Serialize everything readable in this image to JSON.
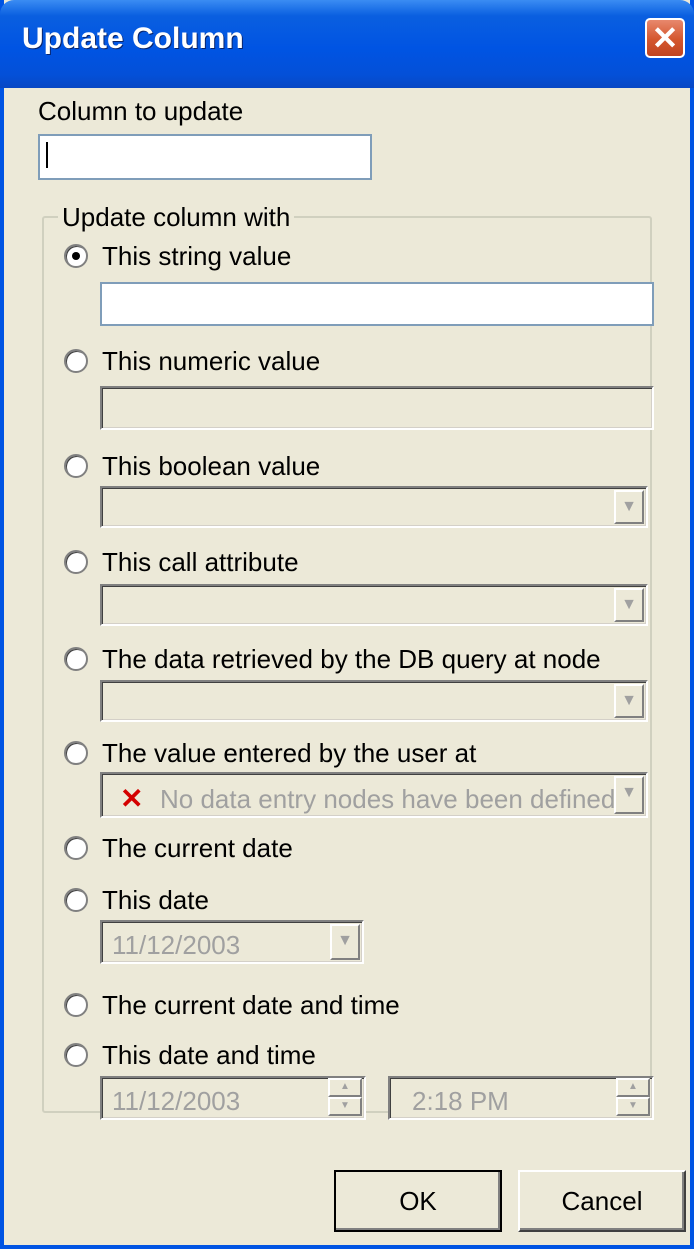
{
  "window": {
    "title": "Update Column",
    "close_glyph": "✕"
  },
  "column_to_update": {
    "label": "Column to update",
    "value": ""
  },
  "group": {
    "legend": "Update column with",
    "options": [
      {
        "label": "This string value",
        "checked": true
      },
      {
        "label": "This numeric value",
        "checked": false
      },
      {
        "label": "This boolean value",
        "checked": false
      },
      {
        "label": "This call attribute",
        "checked": false
      },
      {
        "label": "The data retrieved by the DB query at node",
        "checked": false
      },
      {
        "label": "The value entered by the user at",
        "checked": false
      },
      {
        "label": "The current date",
        "checked": false
      },
      {
        "label": "This date",
        "checked": false
      },
      {
        "label": "The current date and time",
        "checked": false
      },
      {
        "label": "This date and time",
        "checked": false
      }
    ],
    "string_value": "",
    "numeric_value": "",
    "boolean_value": "",
    "call_attribute": "",
    "db_query_node": "",
    "user_entry_node": "No data entry nodes have been defined.",
    "date_value": "11/12/2003",
    "datetime_date": "11/12/2003",
    "datetime_time": "2:18 PM"
  },
  "buttons": {
    "ok": "OK",
    "cancel": "Cancel"
  },
  "icons": {
    "error": "red-x-icon",
    "dropdown": "chevron-down-icon",
    "spin_up": "spin-up-icon",
    "spin_down": "spin-down-icon"
  },
  "colors": {
    "titlebar": "#0054e3",
    "face": "#ece9d8",
    "close": "#d4562d",
    "error": "#d40000"
  }
}
